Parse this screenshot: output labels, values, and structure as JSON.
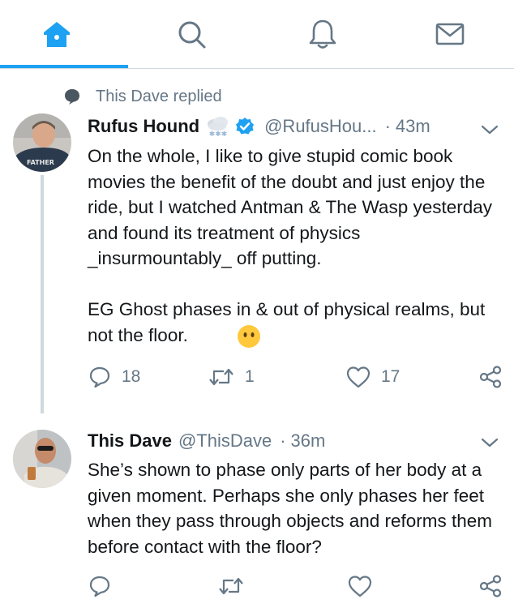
{
  "nav": {
    "tabs": [
      {
        "icon": "home-icon",
        "active": true
      },
      {
        "icon": "search-icon",
        "active": false
      },
      {
        "icon": "bell-icon",
        "active": false
      },
      {
        "icon": "mail-icon",
        "active": false
      }
    ],
    "accent": "#1da1f2"
  },
  "context": {
    "text": "This Dave replied",
    "icon": "speech-bubble-icon"
  },
  "tweets": [
    {
      "name": "Rufus Hound",
      "name_emoji": "snow-cloud-icon",
      "verified": true,
      "handle": "@RufusHou...",
      "sep": "·",
      "time": "43m",
      "avatar_shirt_text": "FATHER",
      "body": [
        "On the whole, I like to give stupid comic book movies the benefit of the doubt and just enjoy the ride, but I watched Antman & The Wasp yesterday and found its treatment of physics _insurmountably_ off putting.",
        "EG Ghost phases in & out of physical realms, but not the floor."
      ],
      "body_emoji": "face-without-mouth-icon",
      "reply_count": "18",
      "retweet_count": "1",
      "like_count": "17"
    },
    {
      "name": "This Dave",
      "handle": "@ThisDave",
      "sep": "·",
      "time": "36m",
      "body": [
        "She’s shown to phase only parts of her body at a given moment. Perhaps she only phases her feet when they pass through objects and reforms them before contact with the floor?"
      ],
      "reply_count": "",
      "retweet_count": "",
      "like_count": ""
    }
  ],
  "colors": {
    "secondary": "#657786",
    "verified": "#1da1f2",
    "divider": "#cfd9de"
  }
}
